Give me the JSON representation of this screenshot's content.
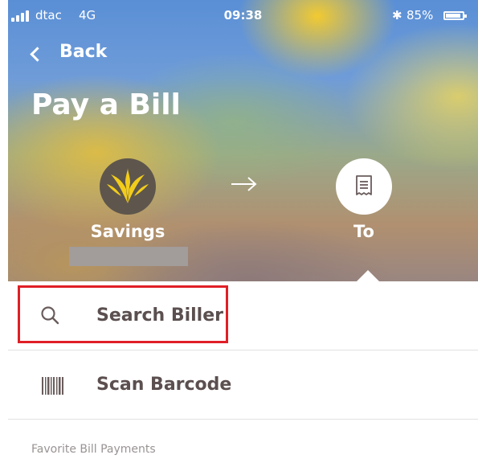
{
  "status_bar": {
    "carrier": "dtac",
    "network": "4G",
    "time": "09:38",
    "bluetooth": "✱",
    "battery_percent": "85%"
  },
  "nav": {
    "back_label": "Back"
  },
  "page": {
    "title": "Pay a Bill"
  },
  "transfer": {
    "from_label": "Savings",
    "arrow": "→",
    "to_label": "To"
  },
  "options": [
    {
      "label": "Search Biller",
      "icon": "search-icon",
      "highlighted": true
    },
    {
      "label": "Scan Barcode",
      "icon": "barcode-icon",
      "highlighted": false
    }
  ],
  "favorites": {
    "header": "Favorite Bill Payments"
  },
  "colors": {
    "highlight_border": "#e01f26",
    "logo_background": "#5e564c",
    "logo_gold": "#f2cc1b",
    "row_text": "#5b4f4f"
  }
}
